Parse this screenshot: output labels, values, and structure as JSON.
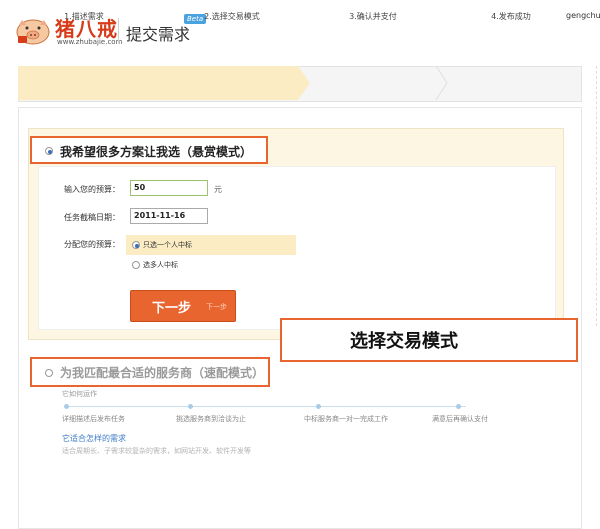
{
  "header": {
    "logo_text": "猪八戒",
    "logo_sub": "www.zhubajie.com",
    "title": "提交需求",
    "beta": "Beta",
    "username": "gengchun"
  },
  "steps": [
    {
      "label": "1.描述需求"
    },
    {
      "label": "2.选择交易模式"
    },
    {
      "label": "3.确认并支付"
    },
    {
      "label": "4.发布成功"
    }
  ],
  "bounty": {
    "title": "我希望很多方案让我选（悬赏模式）",
    "budget_label": "输入您的预算：",
    "budget_value": "50",
    "budget_unit": "元",
    "deadline_label": "任务截稿日期：",
    "deadline_value": "2011-11-16",
    "allocation_label": "分配您的预算：",
    "option_single": "只选一个人中标",
    "option_multi": "选多人中标",
    "next_button": "下一步",
    "next_hint": "下一步"
  },
  "callout": {
    "text": "选择交易模式"
  },
  "speed": {
    "title": "为我匹配最合适的服务商（速配模式）",
    "how_label": "它如何运作",
    "timeline": [
      "详细描述后发布任务",
      "挑选服务商到洽谈为止",
      "中标服务商一对一完成工作",
      "满意后再确认支付"
    ],
    "suit_title": "它适合怎样的需求",
    "suit_desc": "适合周期长、子需求较复杂的需求，如网站开发、软件开发等"
  },
  "colors": {
    "accent": "#e8652f",
    "active_step": "#fcecc4",
    "link": "#3c7cc6"
  }
}
